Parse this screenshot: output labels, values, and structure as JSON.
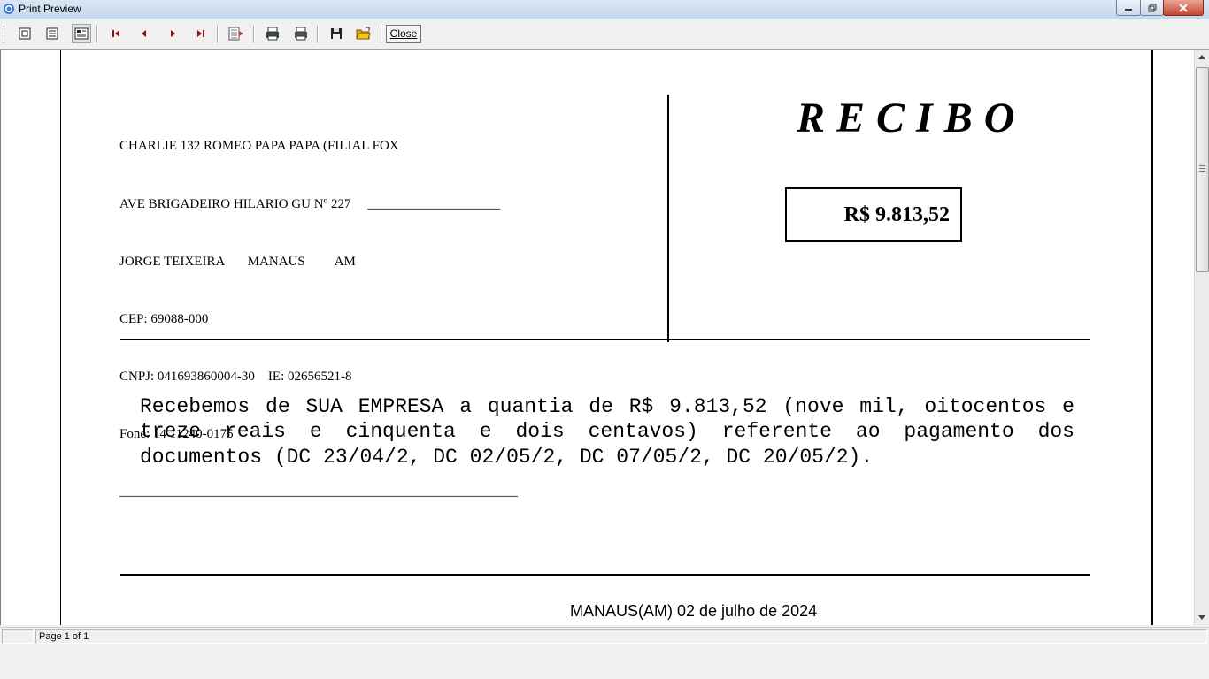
{
  "window": {
    "title": "Print Preview",
    "icon": "print-preview-app-icon"
  },
  "toolbar": {
    "buttons": [
      {
        "name": "one-page-view",
        "icon": "single-page-icon"
      },
      {
        "name": "page-width-view",
        "icon": "page-width-icon"
      },
      {
        "name": "multiple-pages-view",
        "icon": "multi-page-icon",
        "active": true
      },
      {
        "name": "first-page",
        "icon": "first-page-icon"
      },
      {
        "name": "previous-page",
        "icon": "previous-page-icon"
      },
      {
        "name": "next-page",
        "icon": "next-page-icon"
      },
      {
        "name": "last-page",
        "icon": "last-page-icon"
      },
      {
        "name": "goto-page",
        "icon": "goto-page-icon"
      },
      {
        "name": "print-setup",
        "icon": "printer-setup-icon"
      },
      {
        "name": "print",
        "icon": "printer-icon"
      },
      {
        "name": "save",
        "icon": "floppy-disk-icon"
      },
      {
        "name": "open",
        "icon": "open-folder-icon"
      }
    ],
    "close_label": "Close"
  },
  "document": {
    "company_lines": [
      "CHARLIE 132 ROMEO PAPA PAPA (FILIAL FOX",
      "AVE BRIGADEIRO HILARIO GU Nº 227     ____________________",
      "JORGE TEIXEIRA       MANAUS         AM",
      "CEP: 69088-000",
      "CNPJ: 041693860004-30    IE: 02656521-8",
      "Fone: 14 11240-0175",
      "____________________________________________________________"
    ],
    "title": "RECIBO",
    "amount": "R$ 9.813,52",
    "body": "Recebemos de SUA EMPRESA a quantia de R$ 9.813,52 (nove mil, oitocentos e treze reais e cinquenta e dois centavos) referente ao pagamento dos documentos (DC 23/04/2, DC 02/05/2, DC 07/05/2, DC 20/05/2).",
    "place_date": "MANAUS(AM) 02 de julho de 2024"
  },
  "statusbar": {
    "page_info": "Page 1 of 1"
  }
}
